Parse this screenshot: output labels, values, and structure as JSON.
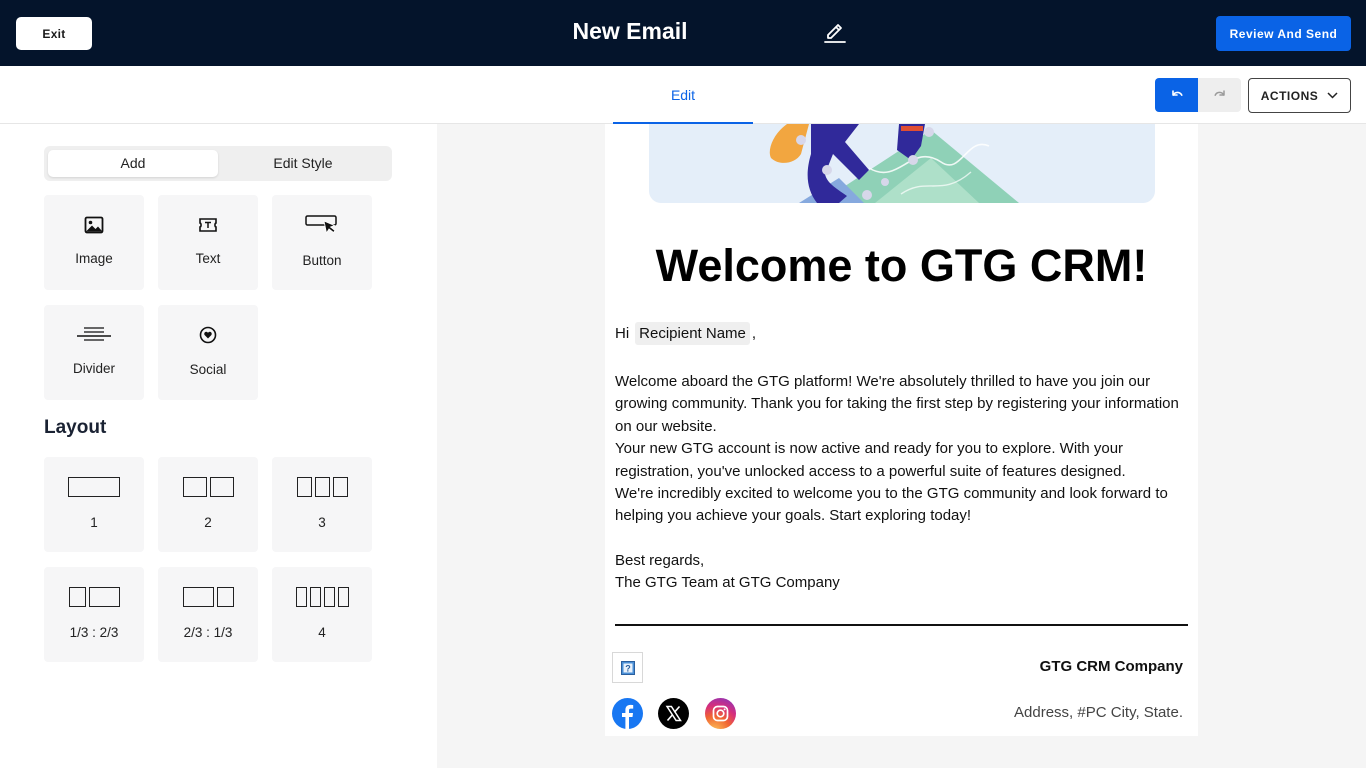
{
  "header": {
    "exit_label": "Exit",
    "title": "New Email",
    "review_label": "Review And Send"
  },
  "subbar": {
    "tab_edit": "Edit",
    "actions_label": "ACTIONS"
  },
  "panel": {
    "tabs": {
      "add": "Add",
      "edit_style": "Edit Style"
    },
    "blocks": {
      "image": "Image",
      "text": "Text",
      "button": "Button",
      "divider": "Divider",
      "social": "Social"
    },
    "layout_heading": "Layout",
    "layouts": {
      "one": "1",
      "two": "2",
      "three": "3",
      "third_twothirds": "1/3 : 2/3",
      "twothirds_third": "2/3 : 1/3",
      "four": "4"
    }
  },
  "email": {
    "heading": "Welcome to GTG CRM!",
    "greeting_prefix": "Hi",
    "recipient_token": "Recipient Name",
    "greeting_suffix": ",",
    "paragraph_1": "Welcome aboard the GTG platform! We're absolutely thrilled to have you join our growing community. Thank you for taking the first step by registering your information on our website.",
    "paragraph_2": "Your new GTG account is now active and ready for you to explore. With your registration, you've unlocked access to a powerful suite of features designed.",
    "paragraph_3": "We're incredibly excited to welcome you to the GTG community and look forward to helping you achieve your goals. Start exploring today!",
    "sign_off": "Best regards,",
    "signature": "The GTG Team at GTG Company",
    "footer_company": "GTG CRM Company",
    "footer_address": "Address, #PC City, State.",
    "logo_placeholder": "?"
  },
  "colors": {
    "topbar": "#04142b",
    "accent": "#0a63e6",
    "facebook": "#1877f2",
    "x": "#000000"
  },
  "icons": [
    "pencil-icon",
    "undo-icon",
    "redo-icon",
    "chevron-down-icon",
    "image-icon",
    "text-icon",
    "button-icon",
    "divider-icon",
    "social-icon",
    "facebook-icon",
    "x-icon",
    "instagram-icon"
  ]
}
